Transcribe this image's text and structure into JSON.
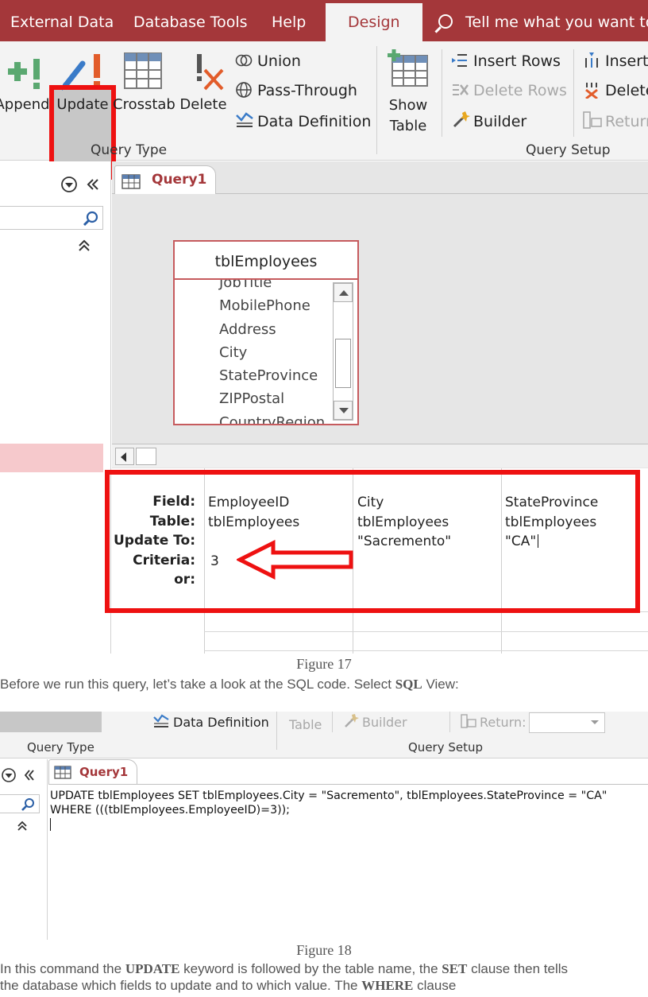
{
  "figure17": {
    "ribbon_tabs": [
      "External Data",
      "Database Tools",
      "Help",
      "Design"
    ],
    "active_tab": "Design",
    "tell_me": "Tell me what you want to",
    "query_type": {
      "buttons": [
        "Append",
        "Update",
        "Crosstab",
        "Delete"
      ],
      "small": [
        "Union",
        "Pass-Through",
        "Data Definition"
      ],
      "group_label": "Query Type"
    },
    "query_setup": {
      "show_table": [
        "Show",
        "Table"
      ],
      "col1": [
        "Insert Rows",
        "Delete Rows",
        "Builder"
      ],
      "col2": [
        "Insert",
        "Delete",
        "Return"
      ],
      "group_label": "Query Setup"
    },
    "query_tab": "Query1",
    "table": {
      "name": "tblEmployees",
      "fields": [
        "JobTitle",
        "MobilePhone",
        "Address",
        "City",
        "StateProvince",
        "ZIPPostal",
        "CountryRegion"
      ]
    },
    "grid": {
      "row_labels": [
        "Field:",
        "Table:",
        "Update To:",
        "Criteria:",
        "or:"
      ],
      "columns": [
        {
          "field": "EmployeeID",
          "table": "tblEmployees",
          "update_to": "",
          "criteria": "3"
        },
        {
          "field": "City",
          "table": "tblEmployees",
          "update_to": "\"Sacremento\"",
          "criteria": ""
        },
        {
          "field": "StateProvince",
          "table": "tblEmployees",
          "update_to": "\"CA\"",
          "criteria": ""
        }
      ]
    },
    "caption": "Figure 17"
  },
  "prose1": {
    "before": "Before we run this query, let’s take a look at the SQL code. Select ",
    "kw": "SQL",
    "after": " View:"
  },
  "figure18": {
    "ribbon": {
      "data_definition": "Data Definition",
      "table": "Table",
      "builder": "Builder",
      "return": "Return:",
      "query_type": "Query Type",
      "query_setup": "Query Setup"
    },
    "query_tab": "Query1",
    "sql_lines": [
      "UPDATE tblEmployees SET tblEmployees.City = \"Sacremento\", tblEmployees.StateProvince = \"CA\"",
      "WHERE (((tblEmployees.EmployeeID)=3));"
    ],
    "caption": "Figure 18"
  },
  "prose2": {
    "p1": "In this command the ",
    "k1": "UPDATE",
    "p2": " keyword is followed by the table name, the ",
    "k2": "SET",
    "p3": " clause then tells",
    "p4": "the database which fields to update and to which value. The ",
    "k3": "WHERE",
    "p5": " clause"
  },
  "colors": {
    "accent": "#a4373a",
    "highlight": "#ee1111"
  }
}
